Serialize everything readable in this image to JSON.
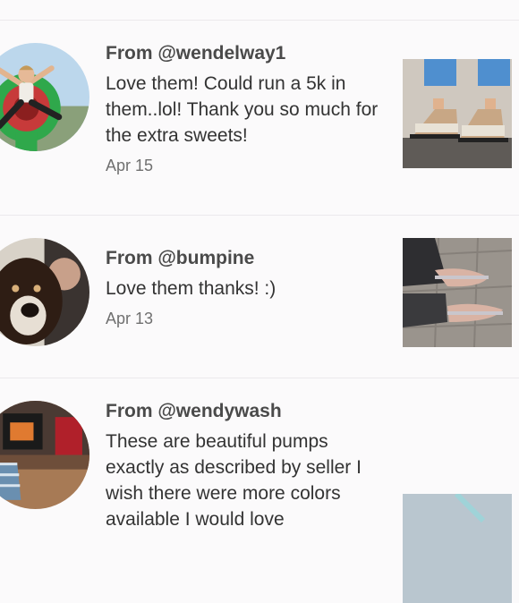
{
  "reviews": [
    {
      "from": "From @wendelway1",
      "text": "Love them! Could run a 5k in them..lol! Thank you so much for the extra sweets!",
      "date": "Apr 15"
    },
    {
      "from": "From @bumpine",
      "text": "Love them thanks! :)",
      "date": "Apr 13"
    },
    {
      "from": "From @wendywash",
      "text": "These are beautiful pumps exactly as described by seller I wish there were more colors available I would love",
      "date": ""
    }
  ]
}
